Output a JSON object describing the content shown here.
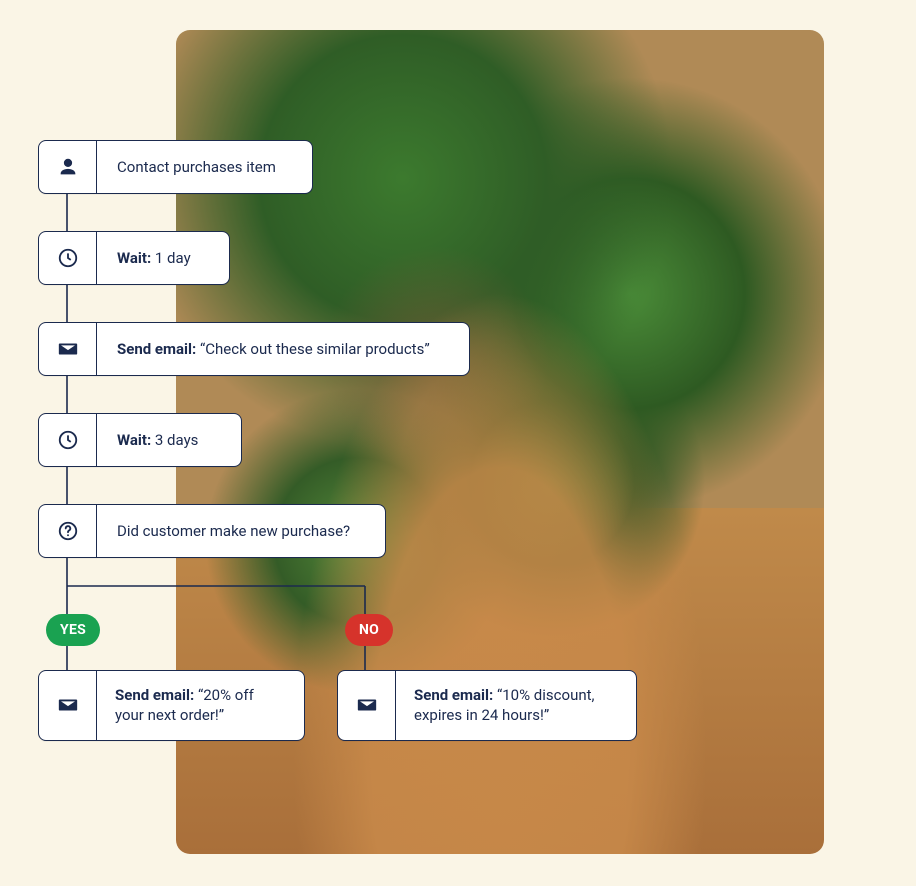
{
  "colors": {
    "page_bg": "#faf5e6",
    "card_bg": "#ffffff",
    "card_border": "#1b2a4e",
    "text": "#1b2a4e",
    "yes_badge": "#1aa251",
    "no_badge": "#d6332b"
  },
  "icons": {
    "person": "person-icon",
    "clock": "clock-icon",
    "envelope": "envelope-icon",
    "question": "question-icon"
  },
  "flow": {
    "trigger": {
      "label": "Contact purchases item"
    },
    "wait1": {
      "bold": "Wait:",
      "rest": " 1 day"
    },
    "email1": {
      "bold": "Send email:",
      "rest": " “Check out these similar products”"
    },
    "wait2": {
      "bold": "Wait:",
      "rest": " 3 days"
    },
    "condition": {
      "label": "Did customer make new purchase?"
    },
    "branches": {
      "yes": {
        "badge": "YES",
        "bold": "Send email:",
        "rest": " “20% off your next order!”"
      },
      "no": {
        "badge": "NO",
        "bold": "Send email:",
        "rest": " “10% discount, expires in 24 hours!”"
      }
    }
  }
}
